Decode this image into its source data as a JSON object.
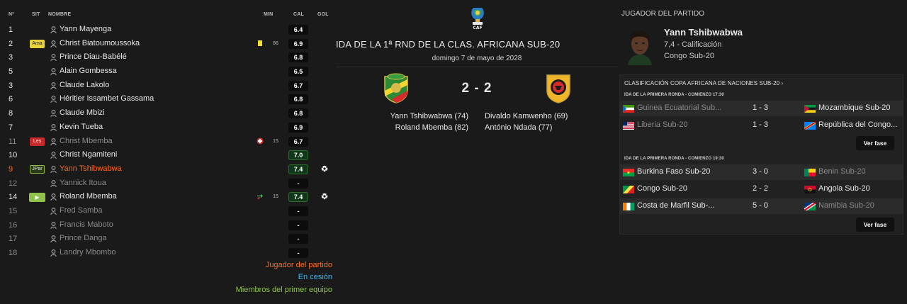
{
  "table": {
    "headers": {
      "num": "Nº",
      "sit": "SIT",
      "name": "NOMBRE",
      "min": "MIN",
      "cal": "CAL",
      "gol": "GOL"
    },
    "rows": [
      {
        "num": "1",
        "name": "Yann Mayenga",
        "cal": "6.4"
      },
      {
        "num": "2",
        "sit": "Ama",
        "name": "Christ Biatoumoussoka",
        "event": "yellow-card-icon",
        "min": "86",
        "cal": "6.9"
      },
      {
        "num": "3",
        "name": "Prince Diau-Babélé",
        "cal": "6.8"
      },
      {
        "num": "5",
        "name": "Alain Gombessa",
        "cal": "6.5"
      },
      {
        "num": "3",
        "name": "Claude Lakolo",
        "cal": "6.7"
      },
      {
        "num": "6",
        "name": "Héritier Issambet Gassama",
        "cal": "6.8"
      },
      {
        "num": "8",
        "name": "Claude Mbizi",
        "cal": "6.8"
      },
      {
        "num": "7",
        "name": "Kevin Tueba",
        "cal": "6.9"
      },
      {
        "num": "11",
        "sit": "Les",
        "name": "Christ Mbemba",
        "event": "injury-icon",
        "min": "15",
        "cal": "6.7"
      },
      {
        "num": "10",
        "name": "Christ Ngamiteni",
        "cal": "7.0"
      },
      {
        "num": "9",
        "sit": "JPar",
        "name": "Yann Tshibwabwa",
        "cal": "7.4",
        "goal": "ball-icon"
      },
      {
        "num": "12",
        "name": "Yannick Itoua",
        "cal": "-"
      },
      {
        "num": "14",
        "sit": "play-icon",
        "name": "Roland Mbemba",
        "event": "substitution-icon",
        "min": "15",
        "cal": "7.4",
        "goal": "ball-icon"
      },
      {
        "num": "15",
        "name": "Fred Samba",
        "cal": "-"
      },
      {
        "num": "16",
        "name": "Francis Maboto",
        "cal": "-"
      },
      {
        "num": "17",
        "name": "Prince Danga",
        "cal": "-"
      },
      {
        "num": "18",
        "name": "Landry Mbombo",
        "cal": "-"
      }
    ]
  },
  "legend": {
    "potm": "Jugador del partido",
    "loan": "En cesión",
    "first_team": "Miembros del primer equipo"
  },
  "match": {
    "competition": "IDA DE LA 1ª RND DE LA CLAS. AFRICANA SUB-20",
    "date": "domingo 7 de mayo de 2028",
    "score": "2 - 2",
    "home_scorers": [
      "Yann Tshibwabwa (74)",
      "Roland Mbemba (82)"
    ],
    "away_scorers": [
      "Divaldo Kamwenho (69)",
      "António Ndada (77)"
    ],
    "cup_logo_text": "CAF"
  },
  "potm": {
    "header": "JUGADOR DEL PARTIDO",
    "name": "Yann Tshibwabwa",
    "rating": "7,4 - Calificación",
    "team": "Congo Sub-20"
  },
  "standings": {
    "title": "CLASIFICACIÓN COPA AFRICANA DE NACIONES SUB-20 ›",
    "groups": [
      {
        "round": "IDA DE LA PRIMERA RONDA - COMIENZO 17:30",
        "fixtures": [
          {
            "home": "Guinea Ecuatorial Sub...",
            "home_flag": "equatorial-guinea-flag-icon",
            "score": "1 - 3",
            "away": "Mozambique Sub-20",
            "away_flag": "mozambique-flag-icon"
          },
          {
            "home": "Liberia Sub-20",
            "home_flag": "liberia-flag-icon",
            "score": "1 - 3",
            "away": "República del Congo...",
            "away_flag": "dr-congo-flag-icon"
          }
        ],
        "button": "Ver fase"
      },
      {
        "round": "IDA DE LA PRIMERA RONDA - COMIENZO 19:30",
        "fixtures": [
          {
            "home": "Burkina Faso Sub-20",
            "home_flag": "burkina-faso-flag-icon",
            "score": "3 - 0",
            "away": "Benin Sub-20",
            "away_flag": "benin-flag-icon"
          },
          {
            "home": "Congo Sub-20",
            "home_flag": "congo-flag-icon",
            "score": "2 - 2",
            "away": "Angola Sub-20",
            "away_flag": "angola-flag-icon"
          },
          {
            "home": "Costa de Marfil Sub-...",
            "home_flag": "ivory-coast-flag-icon",
            "score": "5 - 0",
            "away": "Namibia Sub-20",
            "away_flag": "namibia-flag-icon"
          }
        ],
        "button": "Ver fase"
      }
    ]
  },
  "colors": {
    "background": "#1a1a1b",
    "potm_orange": "#ff6a21",
    "loan_blue": "#35b8f0",
    "first_team_green": "#8fc44a",
    "dim_text": "#8b8b8b"
  }
}
